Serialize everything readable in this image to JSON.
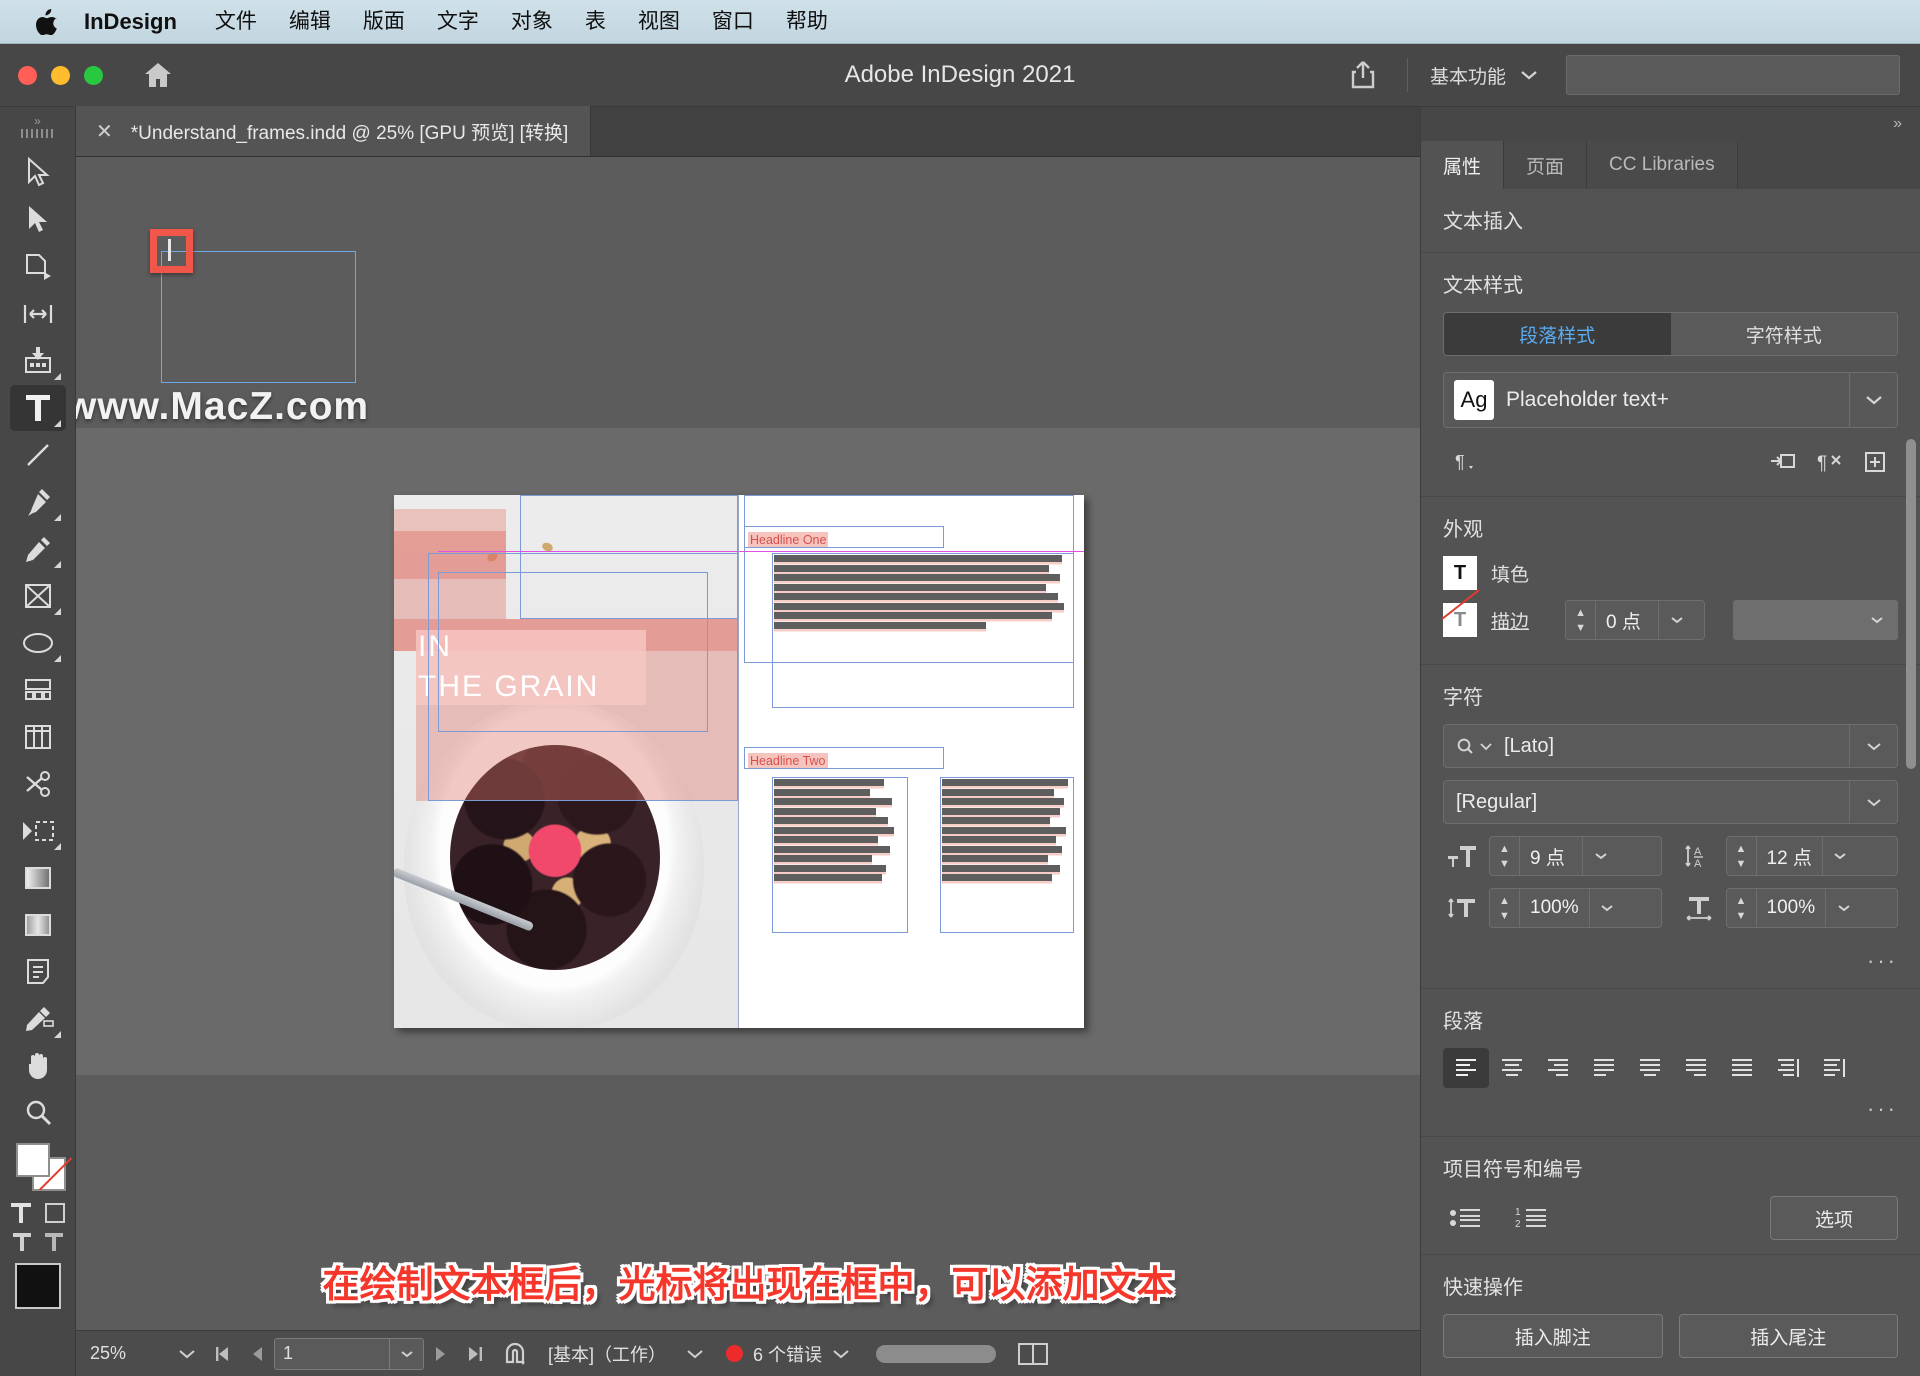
{
  "menubar": {
    "apple_icon": "apple-logo",
    "app_name": "InDesign",
    "items": [
      "文件",
      "编辑",
      "版面",
      "文字",
      "对象",
      "表",
      "视图",
      "窗口",
      "帮助"
    ]
  },
  "titlebar": {
    "title": "Adobe InDesign 2021",
    "share_icon": "share-icon",
    "home_icon": "home-icon",
    "workspace": "基本功能",
    "search_placeholder": ""
  },
  "tabbar": {
    "close_icon": "close-icon",
    "document_tab": "*Understand_frames.indd @ 25% [GPU 预览] [转换]"
  },
  "toolbar": {
    "tools": [
      {
        "name": "selection-tool",
        "active": false
      },
      {
        "name": "direct-selection-tool",
        "active": false
      },
      {
        "name": "page-tool",
        "active": false
      },
      {
        "name": "gap-tool",
        "active": false
      },
      {
        "name": "content-collector-tool",
        "active": false
      },
      {
        "name": "type-tool",
        "active": true
      },
      {
        "name": "line-tool",
        "active": false
      },
      {
        "name": "pen-tool",
        "active": false
      },
      {
        "name": "pencil-tool",
        "active": false
      },
      {
        "name": "frame-tool",
        "active": false
      },
      {
        "name": "ellipse-tool",
        "active": false
      },
      {
        "name": "free-transform-tool",
        "active": false
      },
      {
        "name": "column-tool",
        "active": false
      },
      {
        "name": "scissors-tool",
        "active": false
      },
      {
        "name": "transform-tool",
        "active": false
      },
      {
        "name": "gradient-swatch-tool",
        "active": false
      },
      {
        "name": "gradient-feather-tool",
        "active": false
      },
      {
        "name": "note-tool",
        "active": false
      },
      {
        "name": "eyedropper-tool",
        "active": false
      },
      {
        "name": "hand-tool",
        "active": false
      },
      {
        "name": "zoom-tool",
        "active": false
      }
    ],
    "fill_stroke": {
      "fill": "#ffffff",
      "stroke": "none"
    },
    "format_affects_text_icon": "text-format-icon",
    "format_affects_container_icon": "container-format-icon"
  },
  "canvas": {
    "watermark": "www.MacZ.com",
    "new_frame_tooltip": "text-cursor-highlight",
    "page": {
      "title_lines": [
        "IN",
        "THE GRAIN"
      ],
      "headline_one": "Headline One",
      "headline_two": "Headline Two"
    }
  },
  "caption": "在绘制文本框后，光标将出现在框中，可以添加文本",
  "properties_panel": {
    "collapse_icon": "collapse-panel-icon",
    "tabs": [
      {
        "label": "属性",
        "active": true
      },
      {
        "label": "页面",
        "active": false
      },
      {
        "label": "CC Libraries",
        "active": false
      }
    ],
    "text_insert_title": "文本插入",
    "text_style": {
      "title": "文本样式",
      "segments": [
        {
          "label": "段落样式",
          "active": true
        },
        {
          "label": "字符样式",
          "active": false
        }
      ],
      "style_badge": "Ag",
      "style_name": "Placeholder text+",
      "icons": [
        "paragraph-style-icon",
        "insert-variable-icon",
        "clear-overrides-icon",
        "new-style-icon"
      ]
    },
    "appearance": {
      "title": "外观",
      "fill_label": "填色",
      "fill_icon": "text-fill-icon",
      "stroke_label": "描边",
      "stroke_icon": "text-stroke-none-icon",
      "stroke_weight": "0 点",
      "stroke_type": ""
    },
    "character": {
      "title": "字符",
      "font_family": "[Lato]",
      "font_style": "[Regular]",
      "font_size": "9 点",
      "leading": "12 点",
      "vertical_scale": "100%",
      "horizontal_scale": "100%",
      "search_icon": "font-search-icon",
      "size_icon": "font-size-icon",
      "leading_icon": "leading-icon",
      "vscale_icon": "vertical-scale-icon",
      "hscale_icon": "horizontal-scale-icon",
      "more_options": "···"
    },
    "paragraph": {
      "title": "段落",
      "align_icons": [
        "align-left-icon",
        "align-center-icon",
        "align-right-icon",
        "justify-left-icon",
        "justify-center-icon",
        "justify-right-icon",
        "justify-all-icon",
        "align-toward-spine-icon",
        "align-away-spine-icon"
      ],
      "active_align_index": 0,
      "more_options": "···"
    },
    "bullets": {
      "title": "项目符号和编号",
      "bullet_icon": "bulleted-list-icon",
      "number_icon": "numbered-list-icon",
      "options_label": "选项"
    },
    "quick_actions": {
      "title": "快速操作",
      "buttons": [
        "插入脚注",
        "插入尾注"
      ]
    }
  },
  "statusbar": {
    "zoom": "25%",
    "first_page_icon": "first-page-icon",
    "prev_page_icon": "prev-page-icon",
    "page_number": "1",
    "next_page_icon": "next-page-icon",
    "last_page_icon": "last-page-icon",
    "master_icon": "master-page-icon",
    "master_page": "[基本]（工作）",
    "error_count": "6 个错误",
    "error_color": "#ee2b2b",
    "spread_view_icon": "spread-view-icon"
  },
  "colors": {
    "accent_blue": "#5aabf0",
    "caption_red": "#f5372b",
    "highlight_red": "#f0564a",
    "panel_bg": "#535353",
    "canvas_bg": "#5c5c5c"
  }
}
